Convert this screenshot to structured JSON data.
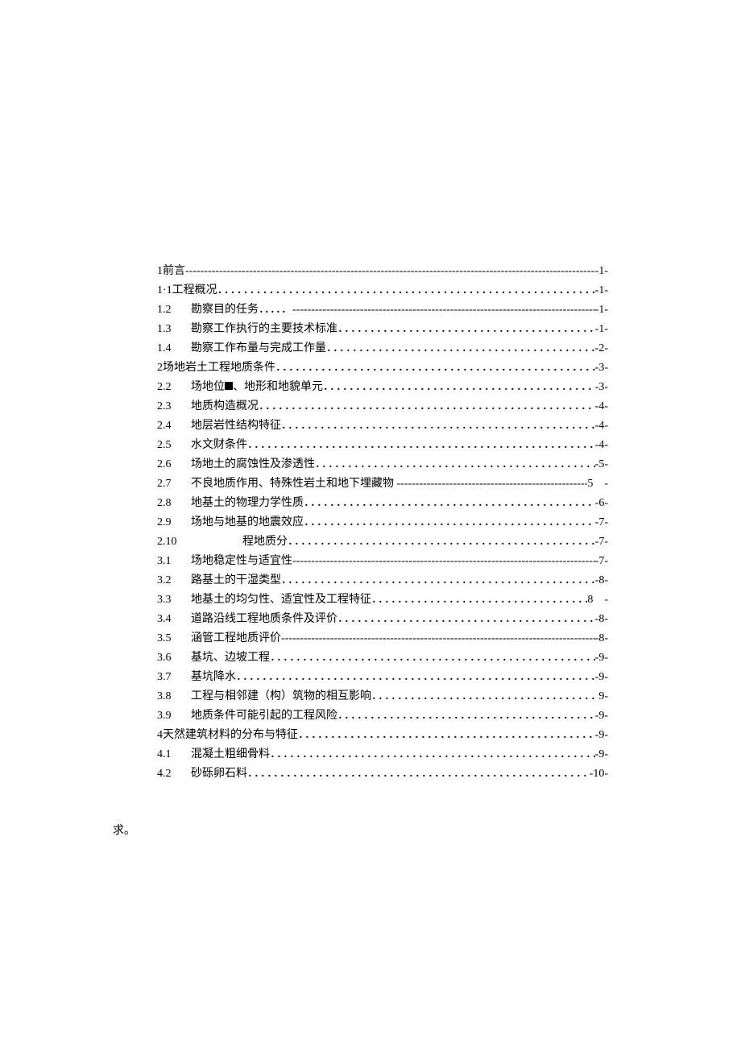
{
  "toc": [
    {
      "type": "heading",
      "num": "1",
      "title": "前言",
      "leader": "dash",
      "page": "-1-"
    },
    {
      "type": "heading",
      "num": "1·1",
      "title": "工程概况",
      "leader": "dot",
      "page": "-1-"
    },
    {
      "type": "line",
      "num": "1.2",
      "title": "勘察目的任务．．．．．",
      "leader": "dash",
      "page": "-1-"
    },
    {
      "type": "line",
      "num": "1.3",
      "title": "勘察工作执行的主要技术标准",
      "leader": "dot-gap",
      "page": "-1-"
    },
    {
      "type": "line",
      "num": "1.4",
      "title": "勘察工作布量与完成工作量",
      "leader": "dot",
      "page": "-2-"
    },
    {
      "type": "heading",
      "num": "2",
      "title": "场地岩土工程地质条件",
      "leader": "dot-gap",
      "page": "-3-"
    },
    {
      "type": "line",
      "num": "2.2",
      "title": "场地位■、地形和地貌单元",
      "leader": "dot",
      "page": "-3-"
    },
    {
      "type": "line",
      "num": "2.3",
      "title": "地质构造概况",
      "leader": "dot",
      "page": "-4-"
    },
    {
      "type": "line",
      "num": "2.4",
      "title": "地层岩性结构特征",
      "leader": "dot",
      "page": "-4-"
    },
    {
      "type": "line",
      "num": "2.5",
      "title": "水文财条件",
      "leader": "dot",
      "page": "-4-"
    },
    {
      "type": "line",
      "num": "2.6",
      "title": "场地土的腐蚀性及渗透性",
      "leader": "dot",
      "page": "-5-"
    },
    {
      "type": "line",
      "num": "2.7",
      "title": "不良地质作用、特殊性岩土和地下埋藏物 ------- ",
      "leader": "dash",
      "page": "5　-"
    },
    {
      "type": "line",
      "num": "2.8",
      "title": "地基土的物理力学性质",
      "leader": "dot",
      "page": "-6-"
    },
    {
      "type": "line",
      "num": "2.9",
      "title": "场地与地基的地震效应",
      "leader": "dot",
      "page": "-7-"
    },
    {
      "type": "line",
      "num": "2.10",
      "title": "　　　　程地质分",
      "leader": "dot",
      "page": "-7-",
      "wide": true
    },
    {
      "type": "line",
      "num": "3.1",
      "title": "场地稳定性与适宜性 ",
      "leader": "dash",
      "page": "-7-"
    },
    {
      "type": "line",
      "num": "3.2",
      "title": "路基土的干湿类型",
      "leader": "dot",
      "page": "-8-"
    },
    {
      "type": "line",
      "num": "3.3",
      "title": "地基土的均匀性、适宜性及工程特征",
      "leader": "dot",
      "page": "8　-"
    },
    {
      "type": "line",
      "num": "3.4",
      "title": "道路沿线工程地质条件及评价",
      "leader": "dot",
      "page": "-8-"
    },
    {
      "type": "line",
      "num": "3.5",
      "title": "涵管工程地质评价 ",
      "leader": "dash",
      "page": "-8-"
    },
    {
      "type": "line",
      "num": "3.6",
      "title": "基坑、边坡工程",
      "leader": "dot",
      "page": "-9-"
    },
    {
      "type": "line",
      "num": "3.7",
      "title": "基坑降水",
      "leader": "dot",
      "page": "-9-"
    },
    {
      "type": "line",
      "num": "3.8",
      "title": "工程与相邻建（构）筑物的相互影响",
      "leader": "dot",
      "page": "9-"
    },
    {
      "type": "line",
      "num": "3.9",
      "title": "地质条件可能引起的工程风险",
      "leader": "dot",
      "page": "-9-"
    },
    {
      "type": "heading",
      "num": "4",
      "title": "天然建筑材料的分布与特征",
      "leader": "dot",
      "page": "-9-"
    },
    {
      "type": "line",
      "num": "4.1",
      "title": "混凝土粗细骨料",
      "leader": "dot",
      "page": "-9-"
    },
    {
      "type": "line",
      "num": "4.2",
      "title": "砂砾卵石料",
      "leader": "dot",
      "page": "-10-"
    }
  ],
  "footer": "求。"
}
